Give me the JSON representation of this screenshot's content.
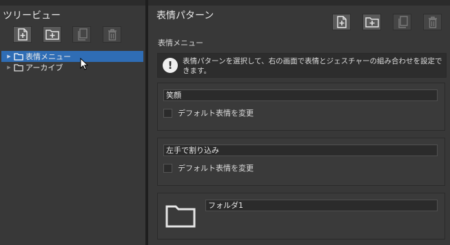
{
  "tree_panel": {
    "title": "ツリービュー",
    "items": [
      {
        "label": "表情メニュー",
        "selected": true
      },
      {
        "label": "アーカイブ",
        "selected": false
      }
    ]
  },
  "main_panel": {
    "title": "表情パターン",
    "breadcrumb": "表情メニュー",
    "info_text": "表情パターンを選択して、右の画面で表情とジェスチャーの組み合わせを設定できます。",
    "cards": [
      {
        "name": "笑顔",
        "checkbox_label": "デフォルト表情を変更"
      },
      {
        "name": "左手で割り込み",
        "checkbox_label": "デフォルト表情を変更"
      }
    ],
    "folder_card": {
      "name": "フォルダ1"
    }
  },
  "toolbar_icons": [
    "add-file-icon",
    "add-folder-icon",
    "copy-icon",
    "trash-icon"
  ],
  "colors": {
    "panel": "#383838",
    "selection": "#2f6db5",
    "button": "#5a5a5a",
    "button_disabled": "#454545"
  }
}
